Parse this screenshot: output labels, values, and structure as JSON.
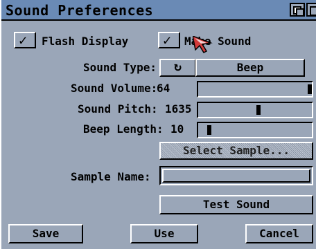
{
  "window": {
    "title": "Sound Preferences"
  },
  "options": {
    "flash_display_label": "Flash Display",
    "flash_display_checked": true,
    "make_sound_label": "Make Sound",
    "make_sound_checked": true
  },
  "fields": {
    "sound_type_label": "Sound Type:",
    "sound_type_value": "Beep",
    "sound_volume_label": "Sound Volume:",
    "sound_volume_value": "64",
    "sound_pitch_label": "Sound Pitch:",
    "sound_pitch_value": "1635",
    "beep_length_label": "Beep Length:",
    "beep_length_value": "10",
    "select_sample_label": "Select Sample...",
    "sample_name_label": "Sample Name:",
    "sample_name_value": "",
    "test_sound_label": "Test Sound"
  },
  "sliders": {
    "volume_fraction": 1.0,
    "pitch_fraction": 0.52,
    "beep_length_fraction": 0.06
  },
  "footer": {
    "save_label": "Save",
    "use_label": "Use",
    "cancel_label": "Cancel"
  },
  "colors": {
    "titlebar": "#6a8ab5",
    "background": "#9aa6b8",
    "pointer": "#d23a3a"
  }
}
